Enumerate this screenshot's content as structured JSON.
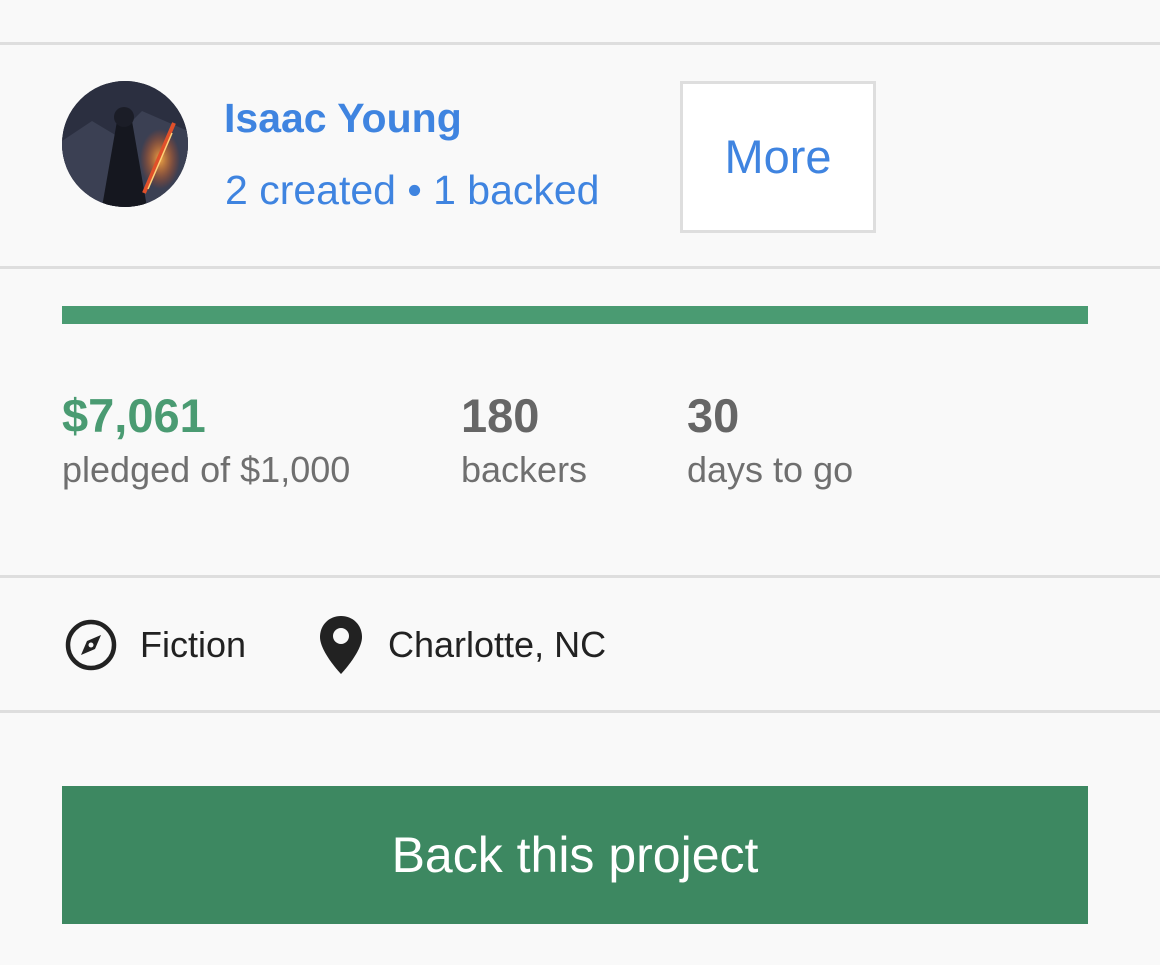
{
  "creator": {
    "name": "Isaac Young",
    "stats": "2 created • 1 backed",
    "more_label": "More"
  },
  "funding": {
    "progress_fraction": 1.0,
    "pledged_amount": "$7,061",
    "pledged_label": "pledged of $1,000",
    "backers_count": "180",
    "backers_label": "backers",
    "days_count": "30",
    "days_label": "days to go"
  },
  "meta": {
    "category": "Fiction",
    "category_icon": "compass-icon",
    "location": "Charlotte, NC",
    "location_icon": "map-pin-icon"
  },
  "cta": {
    "label": "Back this project"
  },
  "colors": {
    "link_blue": "#3f84e0",
    "funded_green": "#4a9b72",
    "cta_green": "#3d8861"
  }
}
